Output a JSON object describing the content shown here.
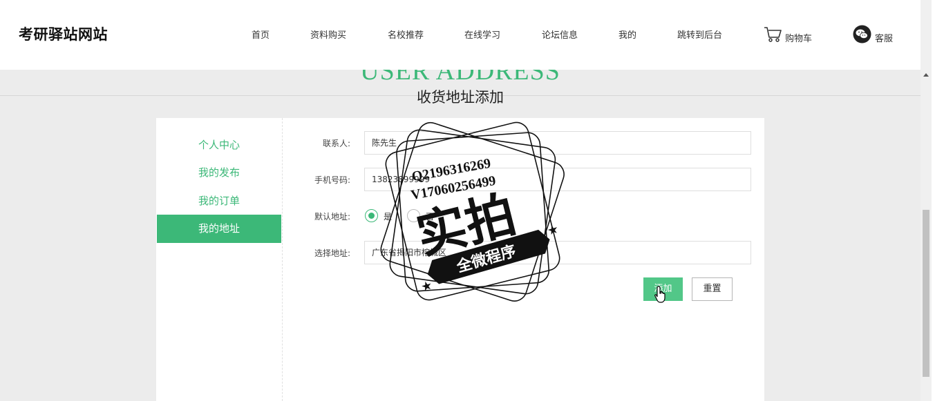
{
  "site": {
    "logo": "考研驿站网站"
  },
  "nav": {
    "items": [
      "首页",
      "资料购买",
      "名校推荐",
      "在线学习",
      "论坛信息",
      "我的",
      "跳转到后台"
    ],
    "cart": "购物车",
    "service": "客服"
  },
  "banner": {
    "en": "USER ADDRESS",
    "cn": "收货地址添加"
  },
  "sidebar": {
    "items": [
      "个人中心",
      "我的发布",
      "我的订单",
      "我的地址"
    ],
    "active_index": 3
  },
  "form": {
    "contact": {
      "label": "联系人:",
      "value": "陈先生"
    },
    "phone": {
      "label": "手机号码:",
      "value": "13823899999"
    },
    "default": {
      "label": "默认地址:",
      "options": [
        "是",
        "否"
      ],
      "selected": "是"
    },
    "address": {
      "label": "选择地址:",
      "value": "广东省揭阳市榕城区"
    },
    "add_button": "添加",
    "reset_button": "重置"
  },
  "watermark": {
    "lines": [
      "Q2196316269",
      "V17060256499"
    ],
    "big": "实拍",
    "banner": "全微程序"
  },
  "colors": {
    "accent": "#3cb878",
    "button": "#52c788"
  }
}
